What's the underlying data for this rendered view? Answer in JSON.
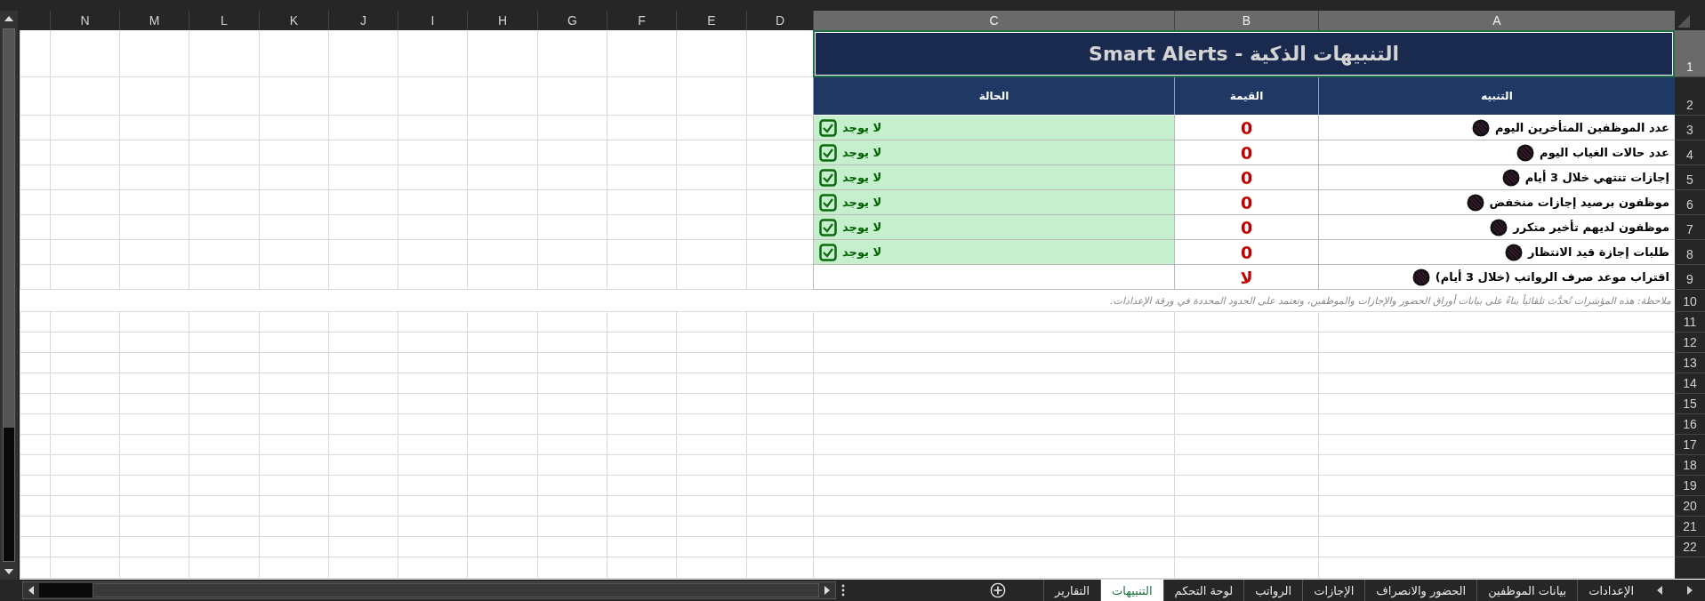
{
  "column_headers": [
    {
      "label": "A",
      "selected": true
    },
    {
      "label": "B",
      "selected": true
    },
    {
      "label": "C",
      "selected": true
    },
    {
      "label": "D",
      "selected": false
    },
    {
      "label": "E",
      "selected": false
    },
    {
      "label": "F",
      "selected": false
    },
    {
      "label": "G",
      "selected": false
    },
    {
      "label": "H",
      "selected": false
    },
    {
      "label": "I",
      "selected": false
    },
    {
      "label": "J",
      "selected": false
    },
    {
      "label": "K",
      "selected": false
    },
    {
      "label": "L",
      "selected": false
    },
    {
      "label": "M",
      "selected": false
    },
    {
      "label": "N",
      "selected": false
    }
  ],
  "row_headers": [
    {
      "label": "1",
      "selected": true
    },
    {
      "label": "2",
      "selected": false
    },
    {
      "label": "3",
      "selected": false
    },
    {
      "label": "4",
      "selected": false
    },
    {
      "label": "5",
      "selected": false
    },
    {
      "label": "6",
      "selected": false
    },
    {
      "label": "7",
      "selected": false
    },
    {
      "label": "8",
      "selected": false
    },
    {
      "label": "9",
      "selected": false
    },
    {
      "label": "10",
      "selected": false
    },
    {
      "label": "11",
      "selected": false
    },
    {
      "label": "12",
      "selected": false
    },
    {
      "label": "13",
      "selected": false
    },
    {
      "label": "14",
      "selected": false
    },
    {
      "label": "15",
      "selected": false
    },
    {
      "label": "16",
      "selected": false
    },
    {
      "label": "17",
      "selected": false
    },
    {
      "label": "18",
      "selected": false
    },
    {
      "label": "19",
      "selected": false
    },
    {
      "label": "20",
      "selected": false
    },
    {
      "label": "21",
      "selected": false
    },
    {
      "label": "22",
      "selected": false
    }
  ],
  "title": "التنبيهات الذكية - Smart Alerts",
  "table_headers": [
    "التنبيه",
    "القيمة",
    "الحالة"
  ],
  "alerts": [
    {
      "name": "عدد الموظفين المتأخرين اليوم",
      "value": "0",
      "status": "لا يوجد"
    },
    {
      "name": "عدد حالات الغياب اليوم",
      "value": "0",
      "status": "لا يوجد"
    },
    {
      "name": "إجازات تنتهي خلال 3 أيام",
      "value": "0",
      "status": "لا يوجد"
    },
    {
      "name": "موظفون برصيد إجازات منخفض",
      "value": "0",
      "status": "لا يوجد"
    },
    {
      "name": "موظفون لديهم تأخير متكرر",
      "value": "0",
      "status": "لا يوجد"
    },
    {
      "name": "طلبات إجازة قيد الانتظار",
      "value": "0",
      "status": "لا يوجد"
    },
    {
      "name": "اقتراب موعد صرف الرواتب (خلال 3 أيام)",
      "value": "لا"
    }
  ],
  "note": "ملاحظة: هذه المؤشرات تُحدَّث تلقائياً بناءً على بيانات أوراق الحضور والإجازات والموظفين، وتعتمد على الحدود المحددة في ورقة الإعدادات.",
  "sheet_tabs": [
    {
      "label": "الإعدادات",
      "selected": false
    },
    {
      "label": "بيانات الموظفين",
      "selected": false
    },
    {
      "label": "الحضور والانصراف",
      "selected": false
    },
    {
      "label": "الإجازات",
      "selected": false
    },
    {
      "label": "الرواتب",
      "selected": false
    },
    {
      "label": "لوحة التحكم",
      "selected": false
    },
    {
      "label": "التنبيهات",
      "selected": true
    },
    {
      "label": "التقارير",
      "selected": false
    }
  ]
}
